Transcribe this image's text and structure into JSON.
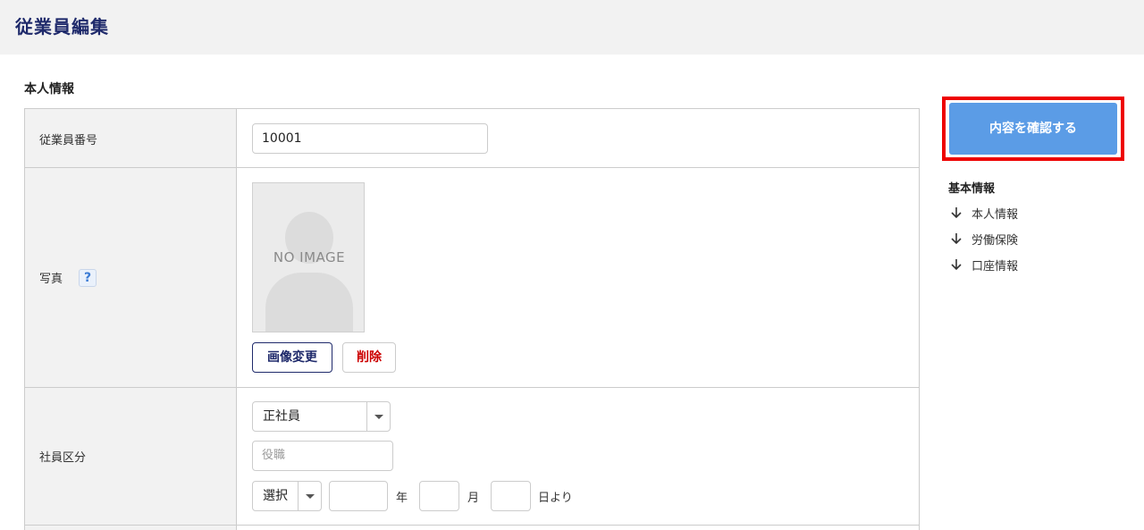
{
  "header": {
    "title": "従業員編集"
  },
  "section": {
    "title": "本人情報"
  },
  "form": {
    "employee_number": {
      "label": "従業員番号",
      "value": "10001"
    },
    "photo": {
      "label": "写真",
      "help": "?",
      "placeholder_text": "NO IMAGE",
      "change_button": "画像変更",
      "delete_button": "削除"
    },
    "employee_type": {
      "label": "社員区分",
      "type_select": "正社員",
      "position_placeholder": "役職",
      "era_select": "選択",
      "year_unit": "年",
      "month_unit": "月",
      "day_unit": "日より"
    }
  },
  "sidebar": {
    "confirm_button": "内容を確認する",
    "nav_title": "基本情報",
    "nav_items": [
      {
        "label": "本人情報",
        "icon": "arrow-down-icon"
      },
      {
        "label": "労働保険",
        "icon": "arrow-down-icon"
      },
      {
        "label": "口座情報",
        "icon": "arrow-down-icon"
      }
    ]
  },
  "colors": {
    "header_bg": "#f2f2f2",
    "title_navy": "#1f2a6b",
    "confirm_blue": "#5b9ce6",
    "highlight_red": "#ee0000",
    "delete_red": "#cc0000"
  }
}
